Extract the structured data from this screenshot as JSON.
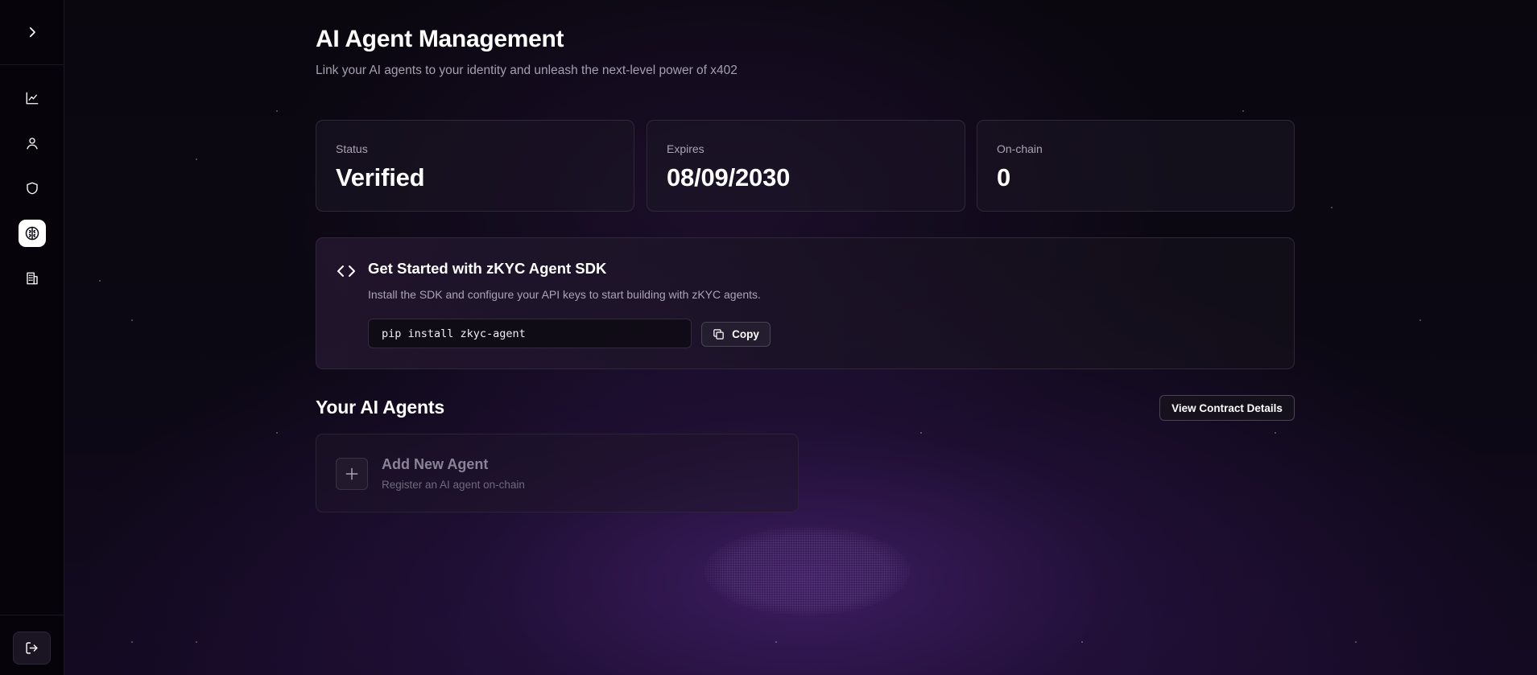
{
  "header": {
    "title": "AI Agent Management",
    "subtitle": "Link your AI agents to your identity and unleash the next-level power of x402"
  },
  "sidebar": {
    "toggle_icon": "chevron-right-icon",
    "items": [
      {
        "icon": "chart-icon",
        "active": false
      },
      {
        "icon": "user-icon",
        "active": false
      },
      {
        "icon": "shield-icon",
        "active": false
      },
      {
        "icon": "brain-icon",
        "active": true
      },
      {
        "icon": "building-icon",
        "active": false
      }
    ],
    "logout_icon": "logout-icon"
  },
  "stats": [
    {
      "label": "Status",
      "value": "Verified"
    },
    {
      "label": "Expires",
      "value": "08/09/2030"
    },
    {
      "label": "On-chain",
      "value": "0"
    }
  ],
  "sdk": {
    "icon": "code-icon",
    "title": "Get Started with zKYC Agent SDK",
    "description": "Install the SDK and configure your API keys to start building with zKYC agents.",
    "command": "pip install zkyc-agent",
    "copy_label": "Copy"
  },
  "agents": {
    "title": "Your AI Agents",
    "contract_button": "View Contract Details",
    "add_title": "Add New Agent",
    "add_subtitle": "Register an AI agent on-chain"
  },
  "colors": {
    "background": "#07050b",
    "accent_purple": "#5a2a8c",
    "card_border": "#2f2839",
    "muted_text": "#aaa3b6"
  }
}
